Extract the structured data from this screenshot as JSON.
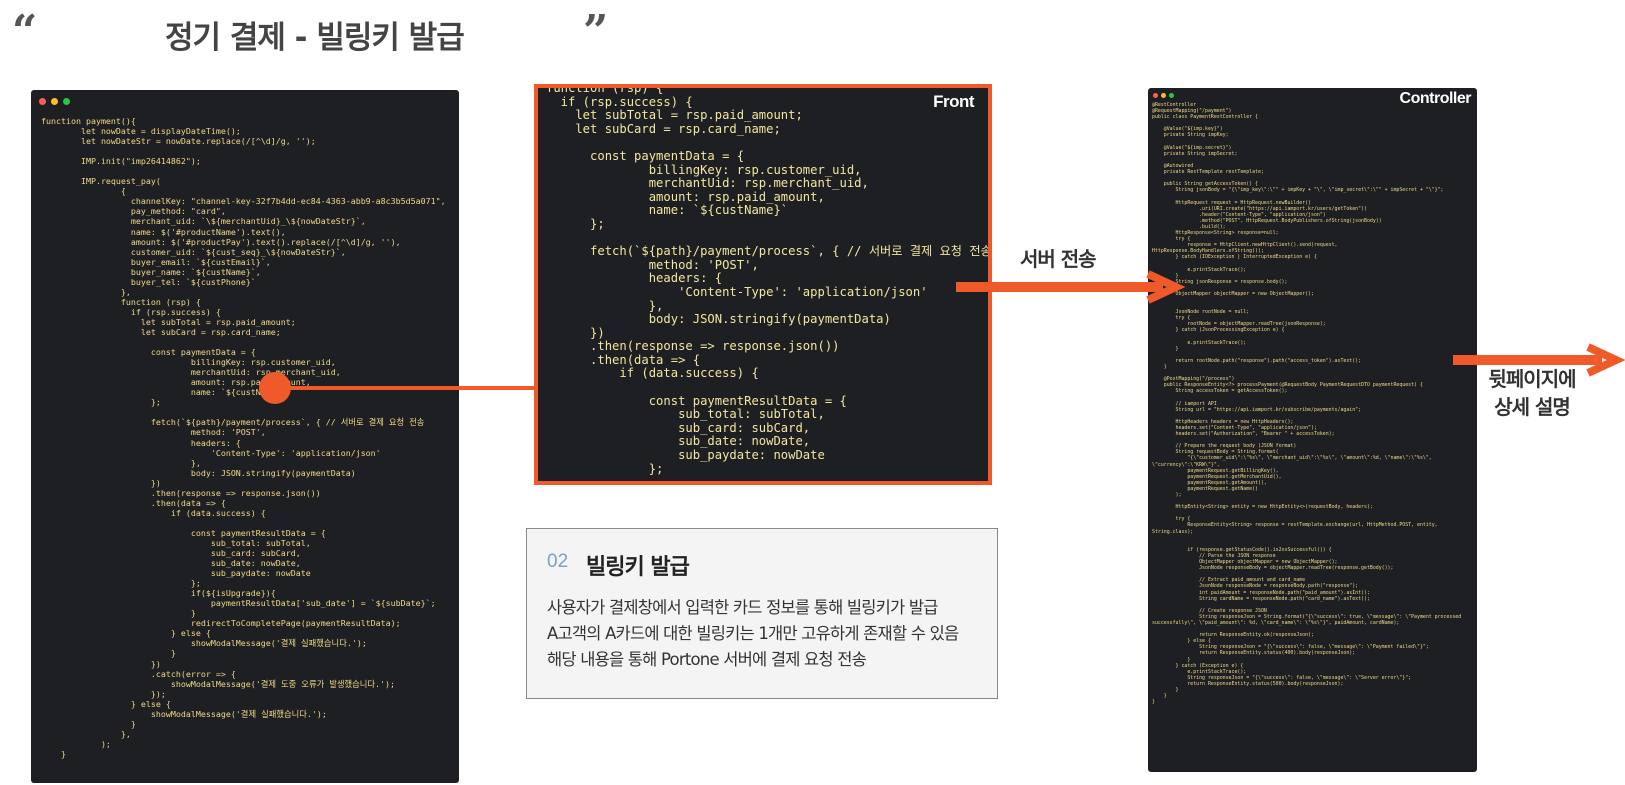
{
  "header": {
    "open_quote": "“",
    "title": "정기 결제 - 빌링키 발급",
    "close_quote": "”"
  },
  "colors": {
    "accent": "#f05a2a",
    "code_bg": "#1e1f23",
    "dot_red": "#ff5f57",
    "dot_yellow": "#febc2e",
    "dot_green": "#28c840"
  },
  "front_panel": {
    "label": "Front"
  },
  "controller_panel": {
    "label": "Controller"
  },
  "arrows": {
    "server_send_label": "서버 전송",
    "next_page_line1": "뒷페이지에",
    "next_page_line2": "상세 설명"
  },
  "info_card": {
    "number": "02",
    "title": "빌링키 발급",
    "lines": [
      "사용자가 결제창에서 입력한 카드 정보를 통해 빌링키가 발급",
      "A고객의 A카드에 대한 빌링키는 1개만 고유하게 존재할 수 있음",
      "해당 내용을 통해 Portone 서버에 결제 요청 전송"
    ]
  },
  "code": {
    "left": "function payment(){\n        let nowDate = displayDateTime();\n        let nowDateStr = nowDate.replace(/[^\\d]/g, '');\n\n        IMP.init(\"imp26414862\");\n\n        IMP.request_pay(\n                {\n                  channelKey: \"channel-key-32f7b4dd-ec84-4363-abb9-a8c3b5d5a071\",\n                  pay_method: \"card\",\n                  merchant_uid: `\\${merchantUid}_\\${nowDateStr}`,\n                  name: $('#productName').text(),\n                  amount: $('#productPay').text().replace(/[^\\d]/g, ''),\n                  customer_uid: `${cust_seq}_\\${nowDateStr}`,\n                  buyer_email: `${custEmail}`,\n                  buyer_name: `${custName}`,\n                  buyer_tel: `${custPhone}`\n                },\n                function (rsp) {\n                  if (rsp.success) {\n                    let subTotal = rsp.paid_amount;\n                    let subCard = rsp.card_name;\n\n                      const paymentData = {\n                              billingKey: rsp.customer_uid,\n                              merchantUid: rsp.merchant_uid,\n                              amount: rsp.paid_amount,\n                              name: `${custName}`\n                      };\n\n                      fetch(`${path}/payment/process`, { // 서버로 결제 요청 전송\n                              method: 'POST',\n                              headers: {\n                                  'Content-Type': 'application/json'\n                              },\n                              body: JSON.stringify(paymentData)\n                      })\n                      .then(response => response.json())\n                      .then(data => {\n                          if (data.success) {\n\n                              const paymentResultData = {\n                                  sub_total: subTotal,\n                                  sub_card: subCard,\n                                  sub_date: nowDate,\n                                  sub_paydate: nowDate\n                              };\n                              if(${isUpgrade}){\n                                  paymentResultData['sub_date'] = `${subDate}`;\n                              }\n                              redirectToCompletePage(paymentResultData);\n                          } else {\n                              showModalMessage('결제 실패했습니다.');\n                          }\n                      })\n                      .catch(error => {\n                          showModalMessage('결제 도중 오류가 발생했습니다.');\n                      });\n                  } else {\n                      showModalMessage('결제 실패했습니다.');\n                  }\n                },\n            );\n    }",
    "front": "function (rsp) {\n  if (rsp.success) {\n    let subTotal = rsp.paid_amount;\n    let subCard = rsp.card_name;\n\n      const paymentData = {\n              billingKey: rsp.customer_uid,\n              merchantUid: rsp.merchant_uid,\n              amount: rsp.paid_amount,\n              name: `${custName}`\n      };\n\n      fetch(`${path}/payment/process`, { // 서버로 결제 요청 전송\n              method: 'POST',\n              headers: {\n                  'Content-Type': 'application/json'\n              },\n              body: JSON.stringify(paymentData)\n      })\n      .then(response => response.json())\n      .then(data => {\n          if (data.success) {\n\n              const paymentResultData = {\n                  sub_total: subTotal,\n                  sub_card: subCard,\n                  sub_date: nowDate,\n                  sub_paydate: nowDate\n              };",
    "controller": "@RestController\n@RequestMapping(\"/payment\")\npublic class PaymentRestController {\n\n    @Value(\"${imp.key}\")\n    private String impKey;\n\n    @Value(\"${imp.secret}\")\n    private String impSecret;\n\n    @Autowired\n    private RestTemplate restTemplate;\n\n    public String getAccessToken() {\n        String jsonBody = \"{\\\"imp_key\\\":\\\"\" + impKey + \"\\\", \\\"imp_secret\\\":\\\"\" + impSecret + \"\\\"}\";\n\n        HttpRequest request = HttpRequest.newBuilder()\n                .uri(URI.create(\"https://api.iamport.kr/users/getToken\"))\n                .header(\"Content-Type\", \"application/json\")\n                .method(\"POST\", HttpRequest.BodyPublishers.ofString(jsonBody))\n                .build();\n        HttpResponse<String> response=null;\n        try {\n            response = HttpClient.newHttpClient().send(request,\nHttpResponse.BodyHandlers.ofString());\n        } catch (IOException | InterruptedException e) {\n\n            e.printStackTrace();\n        }\n        String jsonResponse = response.body();\n\n        ObjectMapper objectMapper = new ObjectMapper();\n\n\n        JsonNode rootNode = null;\n        try {\n            rootNode = objectMapper.readTree(jsonResponse);\n        } catch (JsonProcessingException e) {\n\n            e.printStackTrace();\n        }\n\n        return rootNode.path(\"response\").path(\"access_token\").asText();\n    }\n\n    @PostMapping(\"/process\")\n    public ResponseEntity<?> processPayment(@RequestBody PaymentRequestDTO paymentRequest) {\n        String accessToken = getAccessToken();\n\n        // iamport API\n        String url = \"https://api.iamport.kr/subscribe/payments/again\";\n\n        HttpHeaders headers = new HttpHeaders();\n        headers.set(\"Content-Type\", \"application/json\");\n        headers.set(\"Authorization\", \"Bearer \" + accessToken);\n\n        // Prepare the request body (JSON format)\n        String requestBody = String.format(\n            \"{\\\"customer_uid\\\":\\\"%s\\\", \\\"merchant_uid\\\":\\\"%s\\\", \\\"amount\\\":%d, \\\"name\\\":\\\"%s\\\",\n\\\"currency\\\":\\\"KRW\\\"}\",\n            paymentRequest.getBillingKey(),\n            paymentRequest.getMerchantUid(),\n            paymentRequest.getAmount(),\n            paymentRequest.getName()\n        );\n\n        HttpEntity<String> entity = new HttpEntity<>(requestBody, headers);\n\n        try {\n            ResponseEntity<String> response = restTemplate.exchange(url, HttpMethod.POST, entity,\nString.class);\n\n\n            if (response.getStatusCode().is2xxSuccessful()) {\n                // Parse the JSON response\n                ObjectMapper objectMapper = new ObjectMapper();\n                JsonNode responseBody = objectMapper.readTree(response.getBody());\n\n                // Extract paid_amount and card_name\n                JsonNode responseNode = responseBody.path(\"response\");\n                int paidAmount = responseNode.path(\"paid_amount\").asInt();\n                String cardName = responseNode.path(\"card_name\").asText();\n\n                // Create response JSON\n                String responseJson = String.format(\"{\\\"success\\\": true, \\\"message\\\": \\\"Payment processed\nsuccessfully\\\", \\\"paid_amount\\\": %d, \\\"card_name\\\": \\\"%s\\\"}\", paidAmount, cardName);\n\n                return ResponseEntity.ok(responseJson);\n            } else {\n                String responseJson = \"{\\\"success\\\": false, \\\"message\\\": \\\"Payment failed\\\"}\";\n                return ResponseEntity.status(400).body(responseJson);\n            }\n        } catch (Exception e) {\n            e.printStackTrace();\n            String responseJson = \"{\\\"success\\\": false, \\\"message\\\": \\\"Server error\\\"}\";\n            return ResponseEntity.status(500).body(responseJson);\n        }\n    }\n}"
  }
}
